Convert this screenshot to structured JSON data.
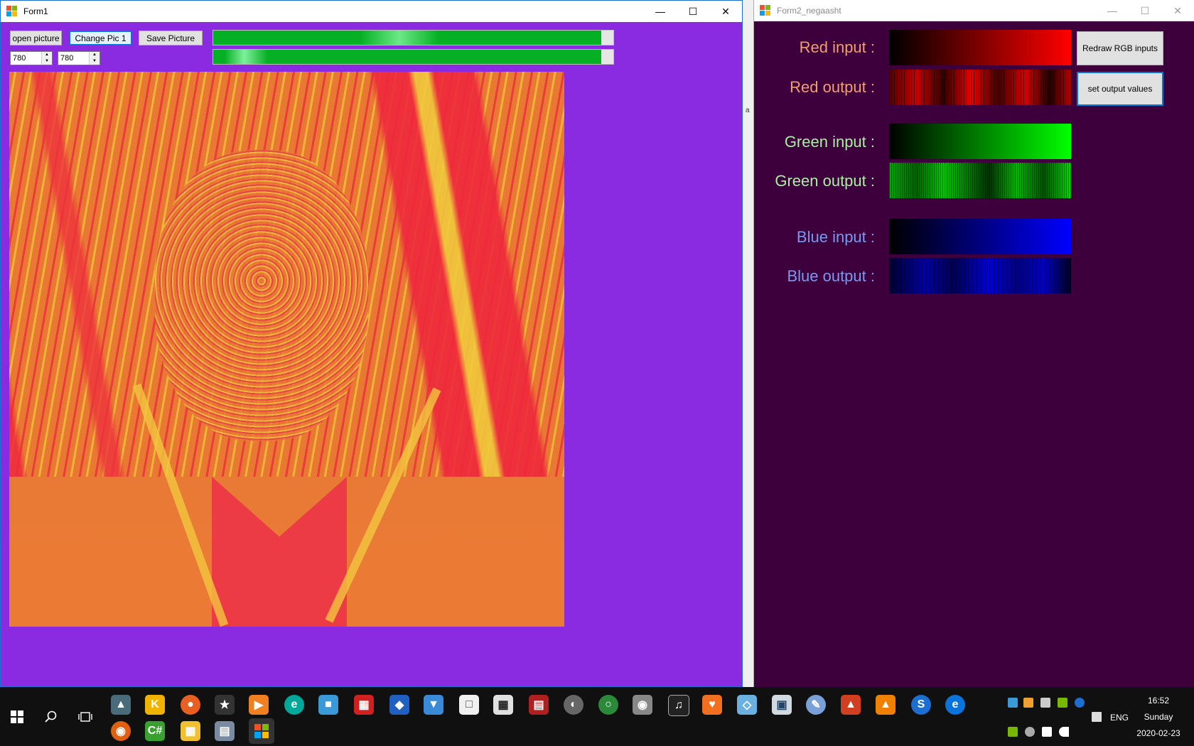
{
  "form1": {
    "title": "Form1",
    "buttons": {
      "open": "open picture",
      "change": "Change Pic 1",
      "save": "Save Picture"
    },
    "width_value": "780",
    "height_value": "780",
    "progress1_percent": 97,
    "progress2_percent": 97
  },
  "form2": {
    "title": "Form2_negaasht",
    "labels": {
      "red_in": "Red input :",
      "red_out": "Red output :",
      "green_in": "Green input :",
      "green_out": "Green output :",
      "blue_in": "Blue input :",
      "blue_out": "Blue output :"
    },
    "colors": {
      "red_label": "#f0a070",
      "green_label": "#a8f0a0",
      "blue_label": "#7a9af0",
      "background": "#3d003d"
    },
    "buttons": {
      "redraw": "Redraw RGB inputs",
      "set_output": "set output values"
    }
  },
  "gap_label": "a",
  "taskbar": {
    "time": "16:52",
    "day": "Sunday",
    "date": "2020-02-23",
    "language": "ENG"
  }
}
